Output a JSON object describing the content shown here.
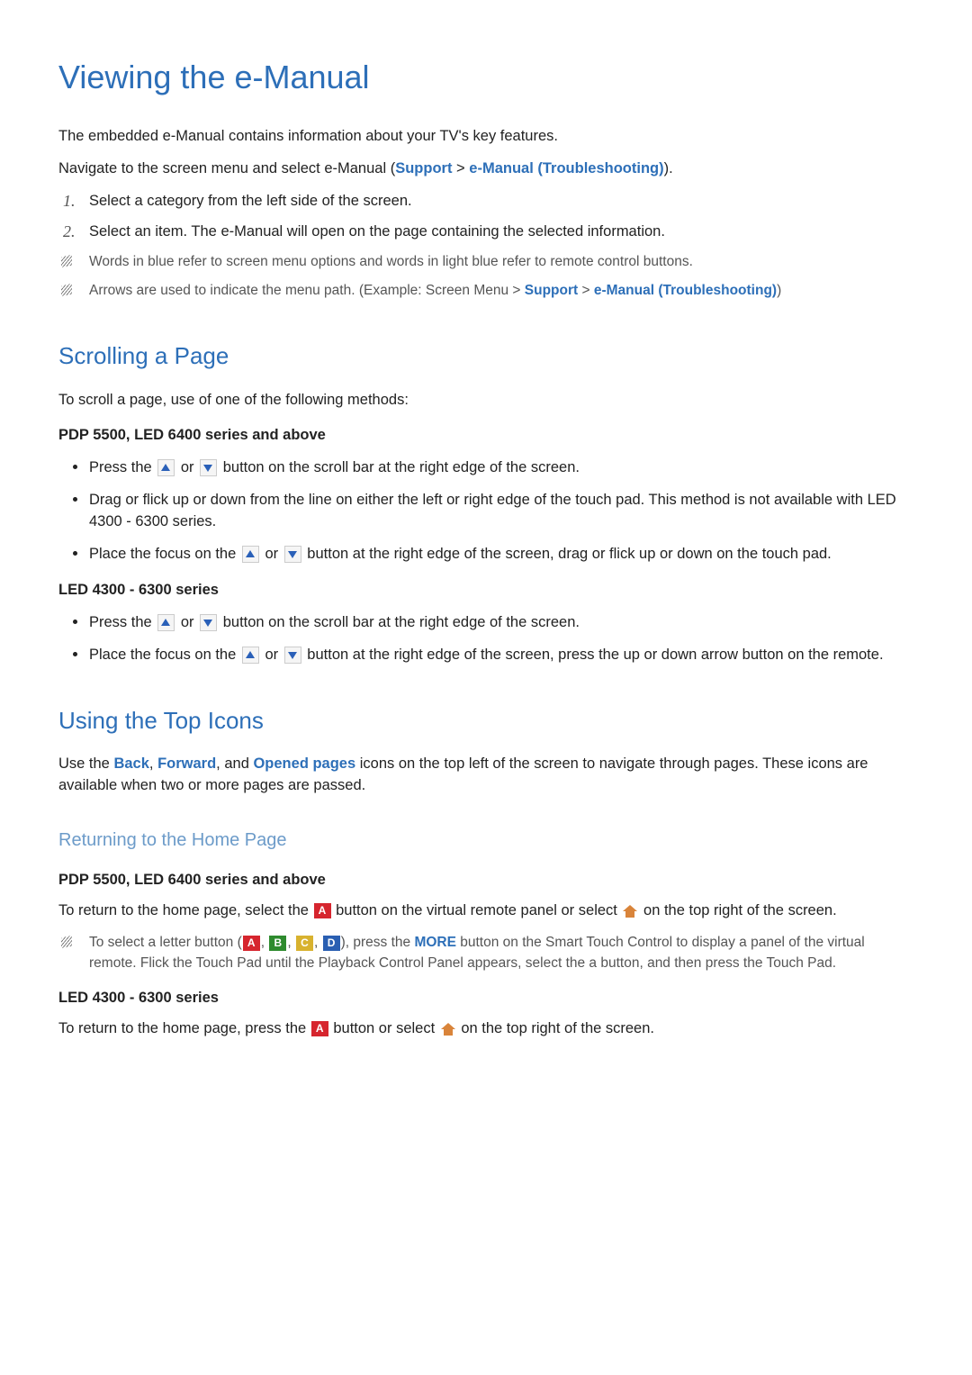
{
  "title": "Viewing the e-Manual",
  "intro1": "The embedded e-Manual contains information about your TV's key features.",
  "intro2_a": "Navigate to the screen menu and select e-Manual (",
  "intro2_support": "Support",
  "intro2_gt": " > ",
  "intro2_eman": "e-Manual (Troubleshooting)",
  "intro2_b": ").",
  "num1": "1.",
  "num2": "2.",
  "step1": "Select a category from the left side of the screen.",
  "step2": "Select an item. The e-Manual will open on the page containing the selected information.",
  "note1": "Words in blue refer to screen menu options and words in light blue refer to remote control buttons.",
  "note2_a": "Arrows are used to indicate the menu path. (Example: Screen Menu > ",
  "note2_support": "Support",
  "note2_gt": " > ",
  "note2_eman": "e-Manual (Troubleshooting)",
  "note2_b": ")",
  "h2_scroll": "Scrolling a Page",
  "scroll_intro": "To scroll a page, use of one of the following methods:",
  "series_a": "PDP 5500, LED 6400 series and above",
  "series_b": "LED 4300 - 6300 series",
  "sb_press_a": "Press the ",
  "sb_or": " or ",
  "sb_press_b": " button on the scroll bar at the right edge of the screen.",
  "sb_drag": "Drag or flick up or down from the line on either the left or right edge of the touch pad. This method is not available with LED 4300 - 6300 series.",
  "sb_focus_a": "Place the focus on the ",
  "sb_focus_b": " button at the right edge of the screen, drag or flick up or down on the touch pad.",
  "sb_focus2_b": " button at the right edge of the screen, press the up or down arrow button on the remote.",
  "h2_icons": "Using the Top Icons",
  "icons_a": "Use the ",
  "icons_back": "Back",
  "icons_c1": ", ",
  "icons_fwd": "Forward",
  "icons_c2": ", and ",
  "icons_open": "Opened pages",
  "icons_b": " icons on the top left of the screen to navigate through pages. These icons are available when two or more pages are passed.",
  "h3_home": "Returning to the Home Page",
  "home1_a": "To return to the home page, select the ",
  "home1_b": " button on the virtual remote panel or select ",
  "home1_c": " on the top right of the screen.",
  "home_note_a": "To select a letter button (",
  "home_note_b": "), press the ",
  "home_note_more": "MORE",
  "home_note_c": " button on the Smart Touch Control to display a panel of the virtual remote. Flick the Touch Pad until the Playback Control Panel appears, select the a button, and then press the Touch Pad.",
  "comma": ", ",
  "letter_a": "A",
  "letter_b": "B",
  "letter_c": "C",
  "letter_d": "D",
  "home2_a": "To return to the home page, press the ",
  "home2_b": " button or select ",
  "home2_c": " on the top right of the screen."
}
